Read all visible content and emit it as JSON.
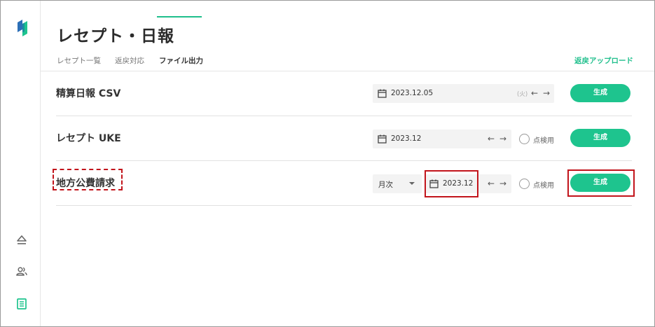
{
  "page": {
    "title": "レセプト・日報"
  },
  "tabs": [
    {
      "label": "レセプト一覧"
    },
    {
      "label": "返戻対応"
    },
    {
      "label": "ファイル出力"
    }
  ],
  "upload_link": "返戻アップロード",
  "colors": {
    "accent": "#1ec48e",
    "highlight": "#c2141b"
  },
  "rows": [
    {
      "label": "精算日報 CSV",
      "date": "2023.12.05",
      "dow": "(火)",
      "button": "生成"
    },
    {
      "label": "レセプト UKE",
      "date": "2023.12",
      "checkbox_label": "点検用",
      "button": "生成"
    },
    {
      "label": "地方公費請求",
      "select_value": "月次",
      "date": "2023.12",
      "checkbox_label": "点検用",
      "button": "生成"
    }
  ],
  "arrows": {
    "prev": "←",
    "next": "→"
  },
  "sidebar": {
    "icons": [
      "logo-icon",
      "eject-icon",
      "users-icon",
      "document-list-icon"
    ]
  }
}
